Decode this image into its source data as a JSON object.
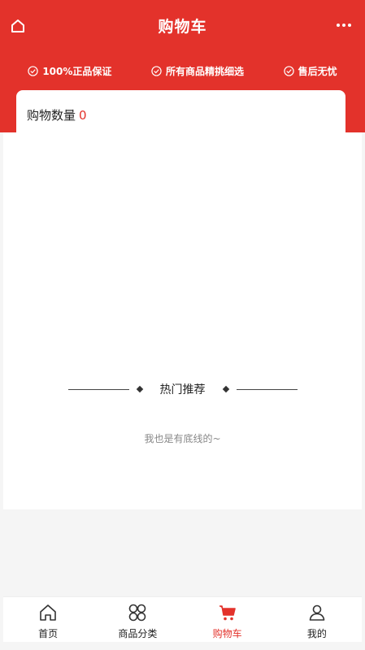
{
  "header": {
    "title": "购物车",
    "home_icon": "home-icon",
    "more_icon": "more-icon",
    "bg_color": "#e3322b"
  },
  "guarantees": [
    {
      "label": "100%正品保证",
      "icon": "check-circle-icon"
    },
    {
      "label": "所有商品精挑细选",
      "icon": "check-circle-icon"
    },
    {
      "label": "售后无忧",
      "icon": "check-circle-icon"
    }
  ],
  "cart": {
    "count_label": "购物数量",
    "count": "0"
  },
  "recommend": {
    "title": "热门推荐",
    "bottom_text": "我也是有底线的~"
  },
  "tabs": [
    {
      "label": "首页",
      "icon": "home-icon",
      "active": false
    },
    {
      "label": "商品分类",
      "icon": "grid-icon",
      "active": false
    },
    {
      "label": "购物车",
      "icon": "cart-icon",
      "active": true
    },
    {
      "label": "我的",
      "icon": "user-icon",
      "active": false
    }
  ],
  "colors": {
    "accent": "#e3322b"
  }
}
